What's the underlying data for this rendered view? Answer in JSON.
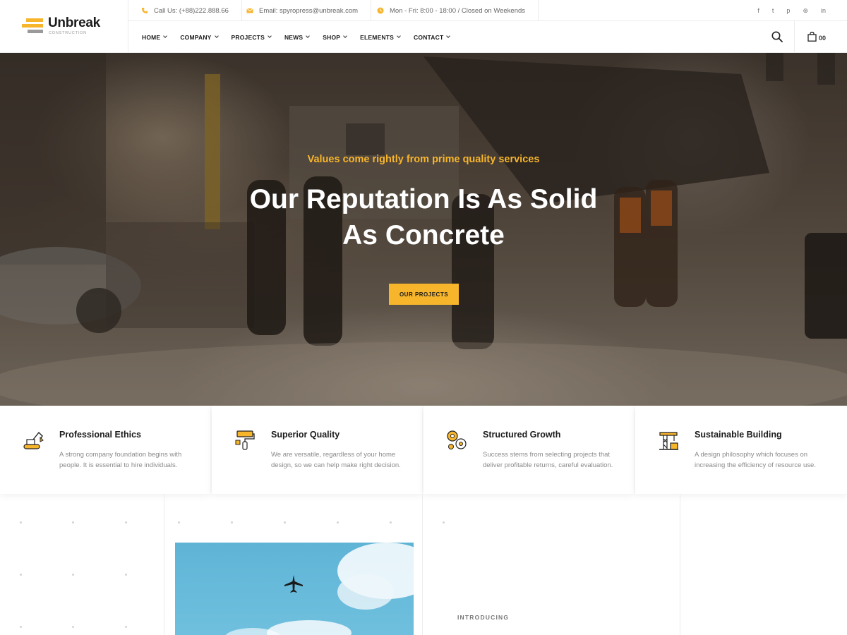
{
  "brand": {
    "name": "Unbreak",
    "subtitle": "CONSTRUCTION",
    "colors": {
      "accent": "#f7b52c",
      "gray": "#9a9a9a",
      "dark": "#1b1b1b"
    }
  },
  "topbar": {
    "phone": {
      "icon": "phone-icon",
      "text": "Call Us: (+88)222.888.66"
    },
    "email": {
      "icon": "mail-icon",
      "text": "Email: spyropress@unbreak.com"
    },
    "hours": {
      "icon": "clock-icon",
      "text": "Mon - Fri: 8:00 - 18:00 / Closed on Weekends"
    },
    "socials": [
      {
        "icon": "facebook-icon",
        "glyph": "f"
      },
      {
        "icon": "twitter-icon",
        "glyph": "t"
      },
      {
        "icon": "pinterest-icon",
        "glyph": "p"
      },
      {
        "icon": "dribbble-icon",
        "glyph": "⊛"
      },
      {
        "icon": "linkedin-icon",
        "glyph": "in"
      }
    ]
  },
  "nav": {
    "items": [
      {
        "label": "HOME"
      },
      {
        "label": "COMPANY"
      },
      {
        "label": "PROJECTS"
      },
      {
        "label": "NEWS"
      },
      {
        "label": "SHOP"
      },
      {
        "label": "ELEMENTS"
      },
      {
        "label": "CONTACT"
      }
    ],
    "search_icon": "search-icon",
    "cart_icon": "shopping-bag-icon",
    "cart_count": "00"
  },
  "hero": {
    "tagline": "Values come rightly from prime quality services",
    "title_line1": "Our Reputation Is As Solid",
    "title_line2": "As Concrete",
    "button_label": "OUR PROJECTS"
  },
  "features": [
    {
      "icon": "excavator-icon",
      "title": "Professional Ethics",
      "text": "A strong company foundation begins with people. It is essential to hire individuals."
    },
    {
      "icon": "paint-roller-icon",
      "title": "Superior Quality",
      "text": "We are versatile, regardless of your home design, so we can help make right decision."
    },
    {
      "icon": "gears-icon",
      "title": "Structured Growth",
      "text": "Success stems from selecting projects that deliver profitable returns, careful evaluation."
    },
    {
      "icon": "crane-icon",
      "title": "Sustainable Building",
      "text": "A design philosophy which focuses on increasing the efficiency of resource use."
    }
  ],
  "about": {
    "eyebrow": "INTRODUCING"
  }
}
